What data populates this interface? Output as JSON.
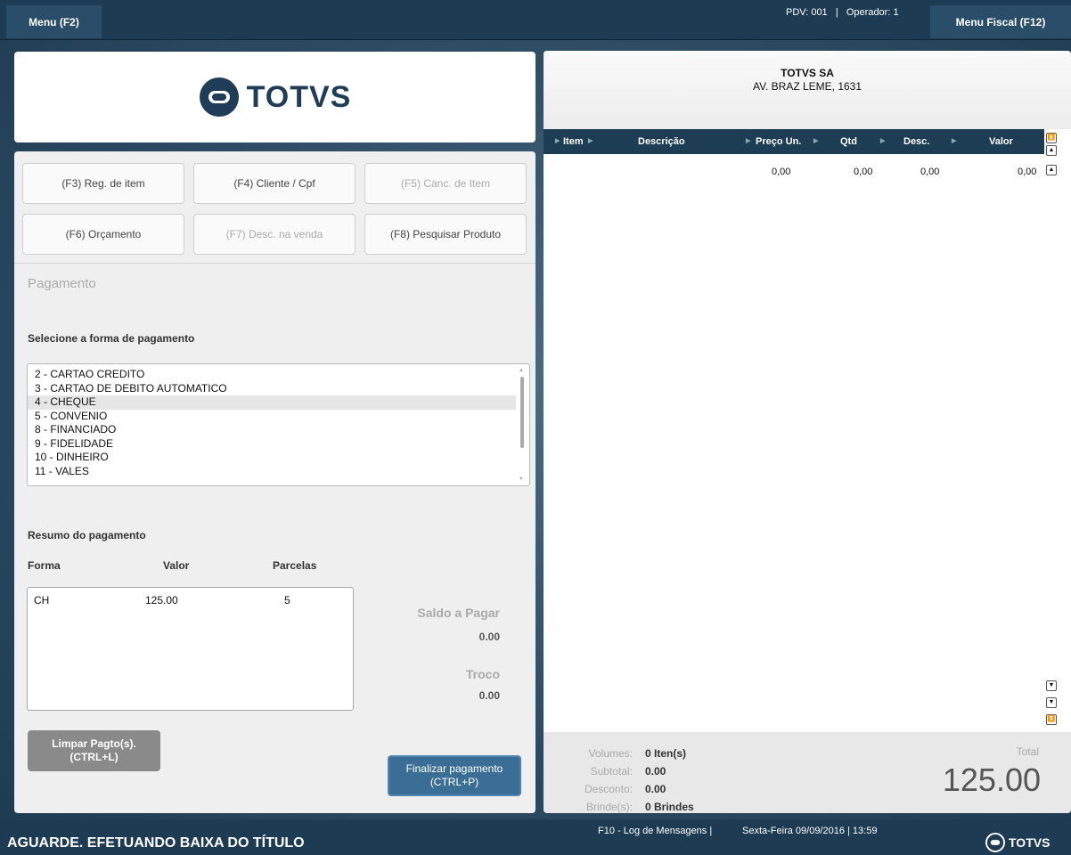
{
  "top": {
    "menu_left": "Menu (F2)",
    "pdv_info": "PDV: 001   |   Operador: 1",
    "menu_right": "Menu Fiscal (F12)"
  },
  "logo": {
    "text": "TOTVS",
    "color": "#1f3d56"
  },
  "fkeys": {
    "f3": "(F3) Reg. de item",
    "f4": "(F4) Cliente / Cpf",
    "f5": "(F5) Canc. de Item",
    "f6": "(F6) Orçamento",
    "f7": "(F7) Desc. na venda",
    "f8": "(F8) Pesquisar Produto"
  },
  "payment": {
    "section_title": "Pagamento",
    "select_label": "Selecione a forma de pagamento",
    "methods": [
      "2 - CARTAO CREDITO",
      "3 - CARTAO DE DEBITO AUTOMATICO",
      "4 - CHEQUE",
      "5 - CONVENIO",
      "8 - FINANCIADO",
      "9 - FIDELIDADE",
      "10 - DINHEIRO",
      "11 - VALES"
    ],
    "selected_method": "4 - CHEQUE"
  },
  "summary": {
    "title": "Resumo do pagamento",
    "col_forma": "Forma",
    "col_valor": "Valor",
    "col_parcelas": "Parcelas",
    "row_forma": "CH",
    "row_valor": "125.00",
    "row_parcelas": "5",
    "saldo_label": "Saldo a Pagar",
    "saldo_value": "0.00",
    "troco_label": "Troco",
    "troco_value": "0.00"
  },
  "buttons": {
    "limpar": "Limpar Pagto(s).\n(CTRL+L)",
    "finalizar": "Finalizar pagamento\n(CTRL+P)"
  },
  "receipt": {
    "company": "TOTVS SA",
    "address": "AV. BRAZ LEME, 1631",
    "headers": {
      "item": "Item",
      "descricao": "Descrição",
      "preco": "Preço Un.",
      "qtd": "Qtd",
      "desc": "Desc.",
      "valor": "Valor"
    },
    "row": {
      "preco": "0,00",
      "qtd": "0,00",
      "desc": "0,00",
      "valor": "0,00"
    }
  },
  "totals": {
    "volumes_label": "Volumes:",
    "volumes_value": "0 Iten(s)",
    "subtotal_label": "Subtotal:",
    "subtotal_value": "0.00",
    "desconto_label": "Desconto:",
    "desconto_value": "0.00",
    "brinde_label": "Brinde(s):",
    "brinde_value": "0 Brindes",
    "total_label": "Total",
    "total_value": "125.00"
  },
  "footer": {
    "status": "AGUARDE. EFETUANDO BAIXA DO TÍTULO",
    "log": "F10 - Log de Mensagens |",
    "datetime": "Sexta-Feira 09/09/2016 | 13:59",
    "logo_text": "TOTVS"
  }
}
